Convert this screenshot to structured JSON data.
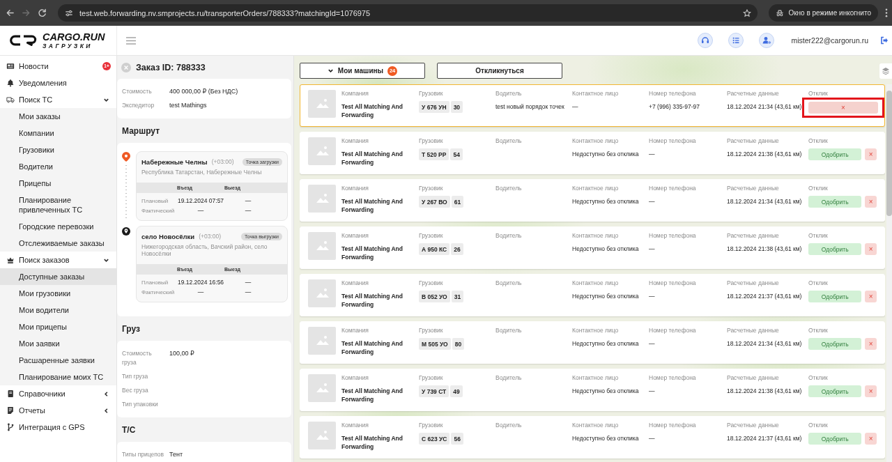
{
  "browser": {
    "nav": [
      {
        "kind": "back",
        "disabled": false
      },
      {
        "kind": "forward",
        "disabled": true
      },
      {
        "kind": "reload",
        "disabled": false
      }
    ],
    "url": "test.web.forwarding.nv.smprojects.ru/transporterOrders/788333?matchingId=1076975",
    "incognito_label": "Окно в режиме инкогнито"
  },
  "header": {
    "logo_title": "CARGO.RUN",
    "logo_subtitle": "ЗАГРУЗКИ",
    "user_email": "mister222@cargorun.ru"
  },
  "sidebar": {
    "items": [
      {
        "label": "Новости",
        "selected": false,
        "badge": "1+"
      },
      {
        "label": "Уведомления",
        "selected": false
      },
      {
        "label": "Поиск ТС",
        "selected": false,
        "expanded": true,
        "children": [
          {
            "label": "Мои заказы",
            "selected": false
          },
          {
            "label": "Компании",
            "selected": false
          },
          {
            "label": "Грузовики",
            "selected": false
          },
          {
            "label": "Водители",
            "selected": false
          },
          {
            "label": "Прицепы",
            "selected": false
          },
          {
            "label": "Планирование привлеченных ТС",
            "selected": false
          },
          {
            "label": "Городские перевозки",
            "selected": false
          },
          {
            "label": "Отслеживаемые заказы",
            "selected": false
          }
        ]
      },
      {
        "label": "Поиск заказов",
        "selected": false,
        "expanded": true,
        "children": [
          {
            "label": "Доступные заказы",
            "selected": true
          },
          {
            "label": "Мои грузовики",
            "selected": false
          },
          {
            "label": "Мои водители",
            "selected": false
          },
          {
            "label": "Мои прицепы",
            "selected": false
          },
          {
            "label": "Мои заявки",
            "selected": false
          },
          {
            "label": "Расшаренные заявки",
            "selected": false
          },
          {
            "label": "Планирование моих ТС",
            "selected": false
          }
        ]
      },
      {
        "label": "Справочники",
        "selected": false,
        "expanded": false
      },
      {
        "label": "Отчеты",
        "selected": false,
        "expanded": false
      },
      {
        "label": "Интеграция с GPS",
        "selected": false
      }
    ]
  },
  "order": {
    "title": "Заказ ID: 788333",
    "summary": [
      {
        "label": "Стоимость",
        "value": "400 000,00 ₽ (Без НДС)"
      },
      {
        "label": "Экспедитор",
        "value": "test Mathings"
      }
    ],
    "route": {
      "title": "Маршрут",
      "stops": [
        {
          "kind": "loading",
          "city": "Набережные Челны",
          "timezone": "(+03:00)",
          "tag": "Точка загрузки",
          "address": "Республика Татарстан, Набережные Челны",
          "columns": [
            "Въезд",
            "Выезд"
          ],
          "rows": [
            {
              "label": "Плановый",
              "entry": "19.12.2024 07:57",
              "exit": "—"
            },
            {
              "label": "Фактический",
              "entry": "—",
              "exit": "—"
            }
          ]
        },
        {
          "kind": "unloading",
          "city": "село Новосёлки",
          "timezone": "(+03:00)",
          "tag": "Точка выгрузки",
          "address": "Нижегородская область, Вачский район, село Новосёлки",
          "columns": [
            "Въезд",
            "Выезд"
          ],
          "rows": [
            {
              "label": "Плановый",
              "entry": "19.12.2024 16:56",
              "exit": "—"
            },
            {
              "label": "Фактический",
              "entry": "—",
              "exit": "—"
            }
          ]
        }
      ]
    },
    "cargo": {
      "title": "Груз",
      "fields": [
        {
          "label": "Стоимость груза",
          "value": "100,00 ₽"
        },
        {
          "label": "Тип груза"
        },
        {
          "label": "Вес груза"
        },
        {
          "label": "Тип упаковки"
        }
      ]
    },
    "vehicle": {
      "title": "Т/С",
      "fields": [
        {
          "label": "Типы прицепов",
          "value": "Тент"
        }
      ]
    }
  },
  "map": {
    "my_vehicles": {
      "label": "Мои машины",
      "count": "24"
    },
    "respond_label": "Откликнуться",
    "cards": [
      {
        "selected": true,
        "company": {
          "label": "Компания",
          "value": "Test All Matching And Forwarding"
        },
        "truck": {
          "label": "Грузовик",
          "plate": "У 676 УН",
          "region": "30"
        },
        "driver": {
          "label": "Водитель",
          "value": "test новый порядок точек"
        },
        "contact": {
          "label": "Контактное лицо",
          "value": "—"
        },
        "phone": {
          "label": "Номер телефона",
          "value": "+7 (996) 335-97-97"
        },
        "calc": {
          "label": "Расчетные данные",
          "value": "18.12.2024 21:34 (43,61 км)"
        },
        "response": {
          "label": "Отклик",
          "highlighted": true,
          "buttons": [
            {
              "kind": "cancel",
              "label": "×"
            }
          ]
        }
      },
      {
        "selected": false,
        "company": {
          "label": "Компания",
          "value": "Test All Matching And Forwarding"
        },
        "truck": {
          "label": "Грузовик",
          "plate": "Т 520 РР",
          "region": "54"
        },
        "driver": {
          "label": "Водитель"
        },
        "contact": {
          "label": "Контактное лицо",
          "value": "Недоступно без отклика"
        },
        "phone": {
          "label": "Номер телефона",
          "value": "—"
        },
        "calc": {
          "label": "Расчетные данные",
          "value": "18.12.2024 21:38 (43,61 км)"
        },
        "response": {
          "label": "Отклик",
          "highlighted": false,
          "buttons": [
            {
              "kind": "approve",
              "label": "Одобрить"
            },
            {
              "kind": "reject",
              "label": "×"
            }
          ]
        }
      },
      {
        "selected": false,
        "company": {
          "label": "Компания",
          "value": "Test All Matching And Forwarding"
        },
        "truck": {
          "label": "Грузовик",
          "plate": "У 267 ВО",
          "region": "61"
        },
        "driver": {
          "label": "Водитель"
        },
        "contact": {
          "label": "Контактное лицо",
          "value": "Недоступно без отклика"
        },
        "phone": {
          "label": "Номер телефона",
          "value": "—"
        },
        "calc": {
          "label": "Расчетные данные",
          "value": "18.12.2024 21:34 (43,61 км)"
        },
        "response": {
          "label": "Отклик",
          "highlighted": false,
          "buttons": [
            {
              "kind": "approve",
              "label": "Одобрить"
            },
            {
              "kind": "reject",
              "label": "×"
            }
          ]
        }
      },
      {
        "selected": false,
        "company": {
          "label": "Компания",
          "value": "Test All Matching And Forwarding"
        },
        "truck": {
          "label": "Грузовик",
          "plate": "А 950 КС",
          "region": "26"
        },
        "driver": {
          "label": "Водитель"
        },
        "contact": {
          "label": "Контактное лицо",
          "value": "Недоступно без отклика"
        },
        "phone": {
          "label": "Номер телефона",
          "value": "—"
        },
        "calc": {
          "label": "Расчетные данные",
          "value": "18.12.2024 21:38 (43,61 км)"
        },
        "response": {
          "label": "Отклик",
          "highlighted": false,
          "buttons": [
            {
              "kind": "approve",
              "label": "Одобрить"
            },
            {
              "kind": "reject",
              "label": "×"
            }
          ]
        }
      },
      {
        "selected": false,
        "company": {
          "label": "Компания",
          "value": "Test All Matching And Forwarding"
        },
        "truck": {
          "label": "Грузовик",
          "plate": "В 052 УО",
          "region": "31"
        },
        "driver": {
          "label": "Водитель"
        },
        "contact": {
          "label": "Контактное лицо",
          "value": "Недоступно без отклика"
        },
        "phone": {
          "label": "Номер телефона",
          "value": "—"
        },
        "calc": {
          "label": "Расчетные данные",
          "value": "18.12.2024 21:37 (43,61 км)"
        },
        "response": {
          "label": "Отклик",
          "highlighted": false,
          "buttons": [
            {
              "kind": "approve",
              "label": "Одобрить"
            },
            {
              "kind": "reject",
              "label": "×"
            }
          ]
        }
      },
      {
        "selected": false,
        "company": {
          "label": "Компания",
          "value": "Test All Matching And Forwarding"
        },
        "truck": {
          "label": "Грузовик",
          "plate": "М 505 УО",
          "region": "80"
        },
        "driver": {
          "label": "Водитель"
        },
        "contact": {
          "label": "Контактное лицо",
          "value": "Недоступно без отклика"
        },
        "phone": {
          "label": "Номер телефона",
          "value": "—"
        },
        "calc": {
          "label": "Расчетные данные",
          "value": "18.12.2024 21:34 (43,61 км)"
        },
        "response": {
          "label": "Отклик",
          "highlighted": false,
          "buttons": [
            {
              "kind": "approve",
              "label": "Одобрить"
            },
            {
              "kind": "reject",
              "label": "×"
            }
          ]
        }
      },
      {
        "selected": false,
        "company": {
          "label": "Компания",
          "value": "Test All Matching And Forwarding"
        },
        "truck": {
          "label": "Грузовик",
          "plate": "У 739 СТ",
          "region": "49"
        },
        "driver": {
          "label": "Водитель"
        },
        "contact": {
          "label": "Контактное лицо",
          "value": "Недоступно без отклика"
        },
        "phone": {
          "label": "Номер телефона",
          "value": "—"
        },
        "calc": {
          "label": "Расчетные данные",
          "value": "18.12.2024 21:38 (43,61 км)"
        },
        "response": {
          "label": "Отклик",
          "highlighted": false,
          "buttons": [
            {
              "kind": "approve",
              "label": "Одобрить"
            },
            {
              "kind": "reject",
              "label": "×"
            }
          ]
        }
      },
      {
        "selected": false,
        "company": {
          "label": "Компания",
          "value": "Test All Matching And Forwarding"
        },
        "truck": {
          "label": "Грузовик",
          "plate": "С 623 УС",
          "region": "56"
        },
        "driver": {
          "label": "Водитель"
        },
        "contact": {
          "label": "Контактное лицо",
          "value": "Недоступно без отклика"
        },
        "phone": {
          "label": "Номер телефона",
          "value": "—"
        },
        "calc": {
          "label": "Расчетные данные",
          "value": "18.12.2024 21:37 (43,61 км)"
        },
        "response": {
          "label": "Отклик",
          "highlighted": false,
          "buttons": [
            {
              "kind": "approve",
              "label": "Одобрить"
            },
            {
              "kind": "reject",
              "label": "×"
            }
          ]
        }
      }
    ]
  }
}
